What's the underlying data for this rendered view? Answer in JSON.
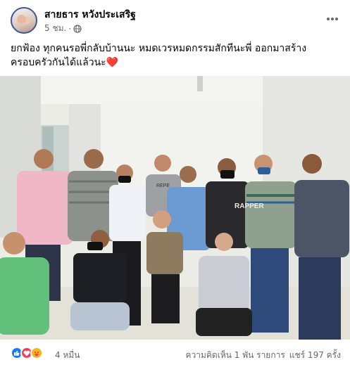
{
  "post": {
    "author": "สายธาร หวังประเสริฐ",
    "time": "5 ชม.",
    "separator": "·",
    "privacy_icon": "globe-icon",
    "text_line1": "ยกฟ้อง ทุกคนรอพี่กลับบ้านนะ หมดเวรหมดกรรมสักทีนะพี่ ออกมาสร้าง",
    "text_line2": "ครอบครัวกันได้แล้วนะ",
    "text_emoji": "❤️"
  },
  "photo": {
    "shirt_text_1": "RAPPER",
    "shirt_text_2": "REPE"
  },
  "reactions": {
    "icons": [
      "like-icon",
      "love-icon",
      "care-icon"
    ],
    "count": "4 หมื่น",
    "comments": "ความคิดเห็น 1 พัน รายการ",
    "shares": "แชร์ 197 ครั้ง"
  },
  "colors": {
    "accent": "#1877f2",
    "love": "#f33e58",
    "care": "#f7b125",
    "secondary_text": "#65676b"
  }
}
